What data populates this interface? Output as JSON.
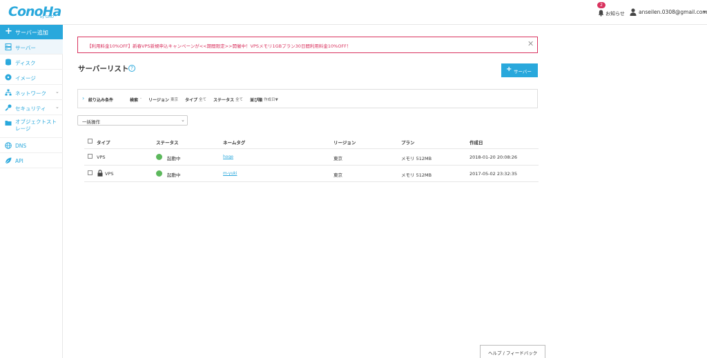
{
  "header": {
    "logo_text": "ConoHa",
    "logo_sub": "by GMO",
    "notice_count": "2",
    "notice_label": "お知らせ",
    "user_email": "anseilen.0308@gmail.com"
  },
  "sidebar": {
    "add_label": "サーバー追加",
    "items": [
      {
        "label": "サーバー",
        "icon": "server-icon"
      },
      {
        "label": "ディスク",
        "icon": "disk-icon"
      },
      {
        "label": "イメージ",
        "icon": "image-icon"
      },
      {
        "label": "ネットワーク",
        "icon": "network-icon"
      },
      {
        "label": "セキュリティ",
        "icon": "key-icon"
      },
      {
        "label": "オブジェクトストレージ",
        "icon": "folder-icon"
      },
      {
        "label": "DNS",
        "icon": "globe-icon"
      },
      {
        "label": "API",
        "icon": "leaf-icon"
      }
    ]
  },
  "banner": {
    "text": "【利用料金10%OFF】新春VPS新規申込キャンペーンが<<期間限定>>開催中！VPSメモリ1GBプラン30日間利用料金10%OFF！",
    "close": "✕"
  },
  "main": {
    "title": "サーバーリスト",
    "help": "?",
    "add_button": "サーバー",
    "filter": {
      "label": "絞り込み条件",
      "search_key": "検索",
      "search_val": "-",
      "region_key": "リージョン",
      "region_val": "東京",
      "type_key": "タイプ",
      "type_val": "全て",
      "status_key": "ステータス",
      "status_val": "全て",
      "sort_key": "並び順",
      "sort_val": "作成日▼"
    },
    "bulk_action": "一括操作",
    "table": {
      "headers": [
        "タイプ",
        "ステータス",
        "ネームタグ",
        "リージョン",
        "プラン",
        "作成日"
      ],
      "rows": [
        {
          "type": "VPS",
          "status": "起動中",
          "name": "hoge",
          "region": "東京",
          "plan": "メモリ 512MB",
          "created": "2018-01-20 20:08:26",
          "locked": false
        },
        {
          "type": "VPS",
          "status": "起動中",
          "name": "m-yuki",
          "region": "東京",
          "plan": "メモリ 512MB",
          "created": "2017-05-02 23:32:35",
          "locked": true
        }
      ]
    }
  },
  "footer": {
    "help_feedback": "ヘルプ / フィードバック"
  },
  "colors": {
    "accent": "#29a8dc",
    "alert": "#d9325e",
    "running": "#5cb85c"
  }
}
